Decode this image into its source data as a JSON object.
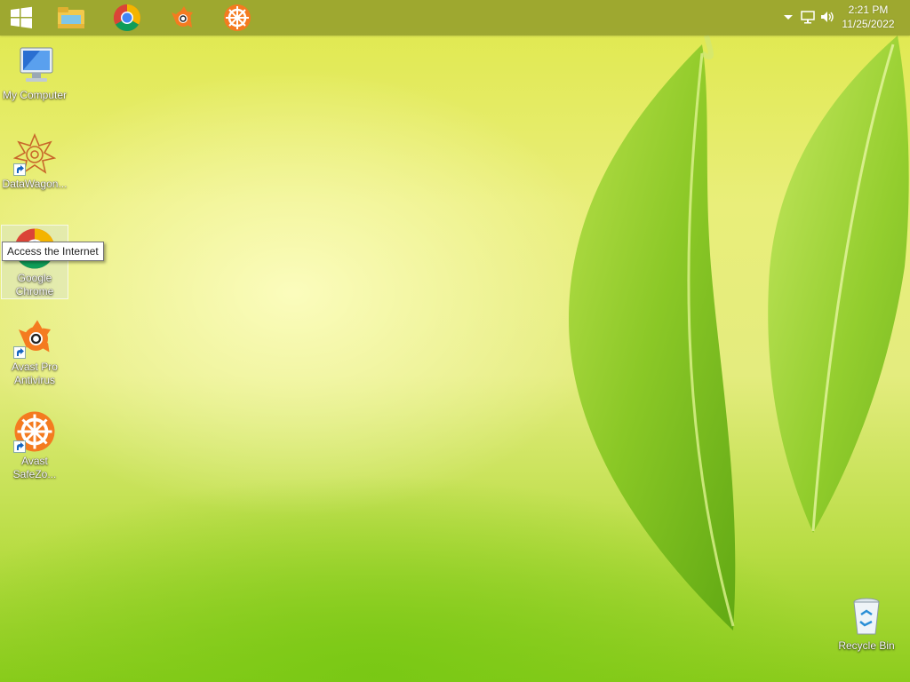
{
  "taskbar": {
    "pinned": [
      {
        "name": "start-button",
        "icon": "windows-logo-icon"
      },
      {
        "name": "file-explorer",
        "icon": "folder-icon"
      },
      {
        "name": "google-chrome",
        "icon": "chrome-icon"
      },
      {
        "name": "avast-antivirus",
        "icon": "avast-icon"
      },
      {
        "name": "avast-safezone",
        "icon": "safezone-icon"
      }
    ],
    "tray": {
      "icons": [
        "chevron-up-icon",
        "network-icon",
        "volume-icon"
      ],
      "time": "2:21 PM",
      "date": "11/25/2022"
    }
  },
  "desktop": {
    "icons": [
      {
        "label": "My Computer"
      },
      {
        "label": "DataWagon..."
      },
      {
        "label": "Google Chrome"
      },
      {
        "label": "Avast Pro Antivirus"
      },
      {
        "label": "Avast SafeZo..."
      },
      {
        "label": "Recycle Bin"
      }
    ],
    "tooltip": "Access the Internet"
  },
  "colors": {
    "taskbar": "#8c9628",
    "avast_orange": "#f47b20",
    "leaf_green": "#7cc21b"
  }
}
